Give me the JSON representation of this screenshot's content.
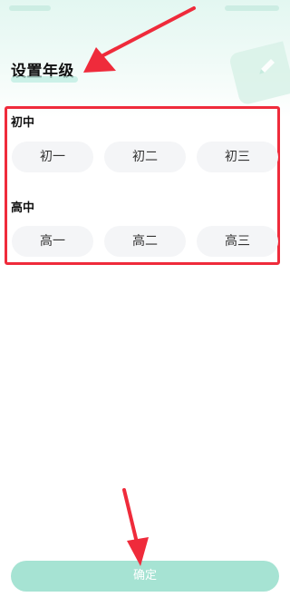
{
  "page": {
    "title": "设置年级"
  },
  "sections": [
    {
      "heading": "初中",
      "grades": [
        "初一",
        "初二",
        "初三"
      ]
    },
    {
      "heading": "高中",
      "grades": [
        "高一",
        "高二",
        "高三"
      ]
    }
  ],
  "footer": {
    "confirm_label": "确定"
  },
  "colors": {
    "accent": "#a6e3d3",
    "highlight_red": "#ef2b3b",
    "chip_bg": "#f4f5f7"
  },
  "icons": [
    "pencil-icon",
    "annotation-arrow"
  ]
}
